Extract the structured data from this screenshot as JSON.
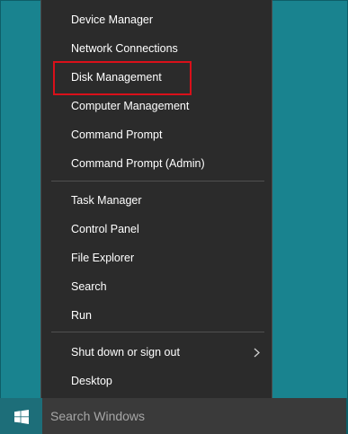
{
  "menu": {
    "items_group1": [
      {
        "label": "Device Manager"
      },
      {
        "label": "Network Connections"
      },
      {
        "label": "Disk Management"
      },
      {
        "label": "Computer Management"
      },
      {
        "label": "Command Prompt"
      },
      {
        "label": "Command Prompt (Admin)"
      }
    ],
    "items_group2": [
      {
        "label": "Task Manager"
      },
      {
        "label": "Control Panel"
      },
      {
        "label": "File Explorer"
      },
      {
        "label": "Search"
      },
      {
        "label": "Run"
      }
    ],
    "items_group3": [
      {
        "label": "Shut down or sign out",
        "icon": "chevron-right-icon"
      },
      {
        "label": "Desktop"
      }
    ],
    "highlight_color": "#d9101a"
  },
  "taskbar": {
    "start_icon": "windows-logo-icon",
    "search_placeholder": "Search Windows"
  },
  "colors": {
    "desktop": "#19838f",
    "menu_background": "#2b2b2b",
    "taskbar": "#0e5e68"
  }
}
